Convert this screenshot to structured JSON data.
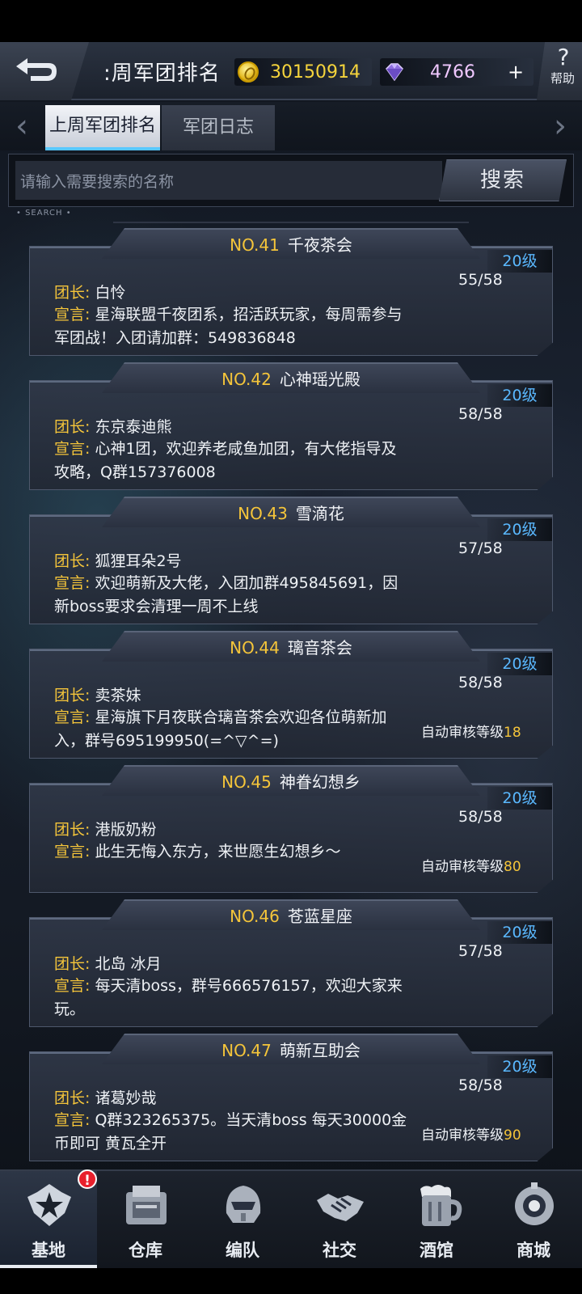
{
  "header": {
    "title": ":周军团排名",
    "gold": "30150914",
    "gems": "4766",
    "plus_label": "+",
    "help_label": "帮助"
  },
  "tabs": [
    {
      "label": "上周军团排名",
      "active": true
    },
    {
      "label": "军团日志",
      "active": false
    }
  ],
  "search": {
    "placeholder": "请输入需要搜索的名称",
    "button_label": "搜索",
    "caption": "• SEARCH •"
  },
  "labels": {
    "leader": "团长:",
    "declaration": "宣言:",
    "auto_review": "自动审核等级"
  },
  "guilds": [
    {
      "rank": "NO.41",
      "name": "千夜茶会",
      "level": "20级",
      "members": "55/58",
      "leader": "白怜",
      "declaration": "星海联盟千夜团系，招活跃玩家，每周需参与军团战！入团请加群：549836848",
      "auto_review_level": ""
    },
    {
      "rank": "NO.42",
      "name": "心神瑶光殿",
      "level": "20级",
      "members": "58/58",
      "leader": "东京泰迪熊",
      "declaration": "心神1团，欢迎养老咸鱼加团，有大佬指导及攻略，Q群157376008",
      "auto_review_level": ""
    },
    {
      "rank": "NO.43",
      "name": "雪滴花",
      "level": "20级",
      "members": "57/58",
      "leader": "狐狸耳朵2号",
      "declaration": "欢迎萌新及大佬，入团加群495845691，因新boss要求会清理一周不上线",
      "auto_review_level": ""
    },
    {
      "rank": "NO.44",
      "name": "璃音茶会",
      "level": "20级",
      "members": "58/58",
      "leader": "卖茶妹",
      "declaration": "星海旗下月夜联合璃音茶会欢迎各位萌新加入，群号695199950(=^▽^=)",
      "auto_review_level": "18"
    },
    {
      "rank": "NO.45",
      "name": "神眷幻想乡",
      "level": "20级",
      "members": "58/58",
      "leader": "港版奶粉",
      "declaration": "此生无悔入东方，来世愿生幻想乡～",
      "auto_review_level": "80"
    },
    {
      "rank": "NO.46",
      "name": "苍蓝星座",
      "level": "20级",
      "members": "57/58",
      "leader": "北岛 冰月",
      "declaration": "每天清boss，群号666576157，欢迎大家来玩。",
      "auto_review_level": ""
    },
    {
      "rank": "NO.47",
      "name": "萌新互助会",
      "level": "20级",
      "members": "58/58",
      "leader": "诸葛妙哉",
      "declaration": "Q群323265375。当天清boss 每天30000金币即可 黄瓦全开",
      "auto_review_level": "90"
    }
  ],
  "nav": [
    {
      "label": "基地",
      "icon": "base-star-icon",
      "active": true,
      "badge": "!"
    },
    {
      "label": "仓库",
      "icon": "warehouse-icon",
      "active": false
    },
    {
      "label": "编队",
      "icon": "helmet-icon",
      "active": false
    },
    {
      "label": "社交",
      "icon": "handshake-icon",
      "active": false
    },
    {
      "label": "酒馆",
      "icon": "beer-mug-icon",
      "active": false
    },
    {
      "label": "商城",
      "icon": "shop-robot-icon",
      "active": false
    }
  ]
}
